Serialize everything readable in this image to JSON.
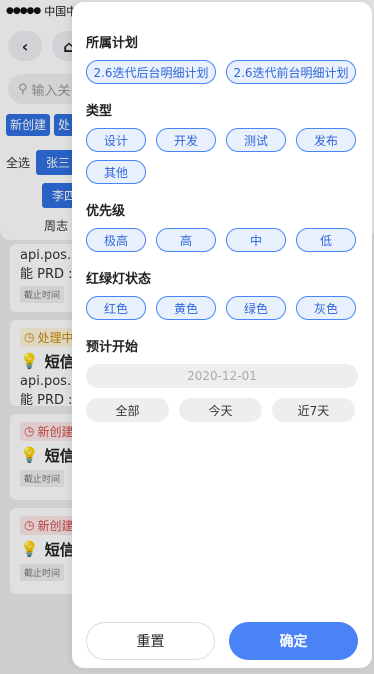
{
  "background": {
    "status_bar": {
      "signal": "●●●●●",
      "carrier": "中国中"
    },
    "nav": {
      "back_icon": "chevron-left-icon",
      "home_icon": "home-icon"
    },
    "search": {
      "placeholder": "输入关"
    },
    "tabs": [
      {
        "label": "新创建"
      },
      {
        "label": "处"
      }
    ],
    "assignee": {
      "select_all": "全选",
      "people": [
        "张三",
        "李四"
      ]
    },
    "weekly": "周志",
    "cards": [
      {
        "url": "api.pos.",
        "prd": "能 PRD :",
        "deadline": "截止时间"
      },
      {
        "status": "处理中",
        "title": "短信",
        "url": "api.pos.",
        "prd": "能 PRD :",
        "deadline": "截止时间"
      },
      {
        "status": "新创建",
        "title": "短信",
        "deadline": "截止时间"
      },
      {
        "status": "新创建",
        "title": "短信",
        "deadline": "截止时间"
      }
    ]
  },
  "filter": {
    "plan": {
      "title": "所属计划",
      "options": [
        "2.6迭代后台明细计划",
        "2.6迭代前台明细计划"
      ]
    },
    "type": {
      "title": "类型",
      "options": [
        "设计",
        "开发",
        "测试",
        "发布",
        "其他"
      ]
    },
    "priority": {
      "title": "优先级",
      "options": [
        "极高",
        "高",
        "中",
        "低"
      ]
    },
    "traffic_light": {
      "title": "红绿灯状态",
      "options": [
        "红色",
        "黄色",
        "绿色",
        "灰色"
      ]
    },
    "start": {
      "title": "预计开始",
      "date": "2020-12-01",
      "quick": [
        "全部",
        "今天",
        "近7天"
      ]
    },
    "footer": {
      "reset": "重置",
      "confirm": "确定"
    }
  }
}
